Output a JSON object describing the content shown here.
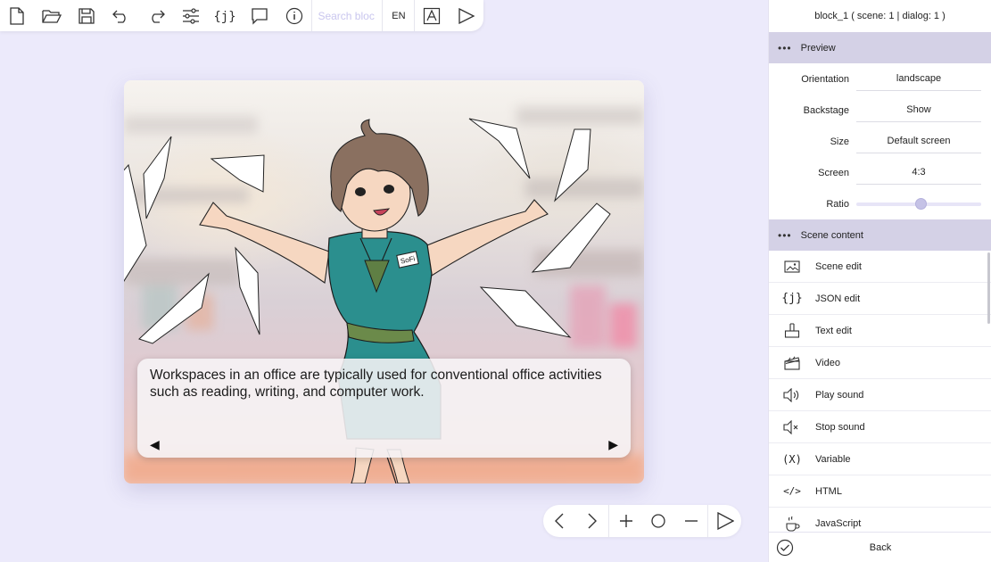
{
  "toolbar": {
    "search_placeholder": "Search bloc",
    "language": "EN"
  },
  "stage": {
    "dialog_text": "Workspaces in an office are typically used for conventional office activities such as reading, writing, and computer work.",
    "prev_arrow": "◀",
    "next_arrow": "▶",
    "badge": "SoFi"
  },
  "panel": {
    "title": "block_1 ( scene: 1 | dialog: 1 )",
    "preview_section": "Preview",
    "scene_content_section": "Scene content",
    "section_dots": "•••",
    "properties": [
      {
        "label": "Orientation",
        "value": "landscape"
      },
      {
        "label": "Backstage",
        "value": "Show"
      },
      {
        "label": "Size",
        "value": "Default screen"
      },
      {
        "label": "Screen",
        "value": "4:3"
      }
    ],
    "ratio_label": "Ratio",
    "ratio_value": 0.52,
    "items": [
      {
        "label": "Scene edit",
        "icon": "image-icon"
      },
      {
        "label": "JSON edit",
        "icon": "json-icon",
        "glyph": "{j}"
      },
      {
        "label": "Text edit",
        "icon": "text-edit-icon"
      },
      {
        "label": "Video",
        "icon": "clapperboard-icon"
      },
      {
        "label": "Play sound",
        "icon": "speaker-on-icon"
      },
      {
        "label": "Stop sound",
        "icon": "speaker-mute-icon"
      },
      {
        "label": "Variable",
        "icon": "variable-icon",
        "glyph": "(X)"
      },
      {
        "label": "HTML",
        "icon": "html-icon",
        "glyph": "</>"
      },
      {
        "label": "JavaScript",
        "icon": "coffee-icon"
      }
    ],
    "back_label": "Back"
  }
}
